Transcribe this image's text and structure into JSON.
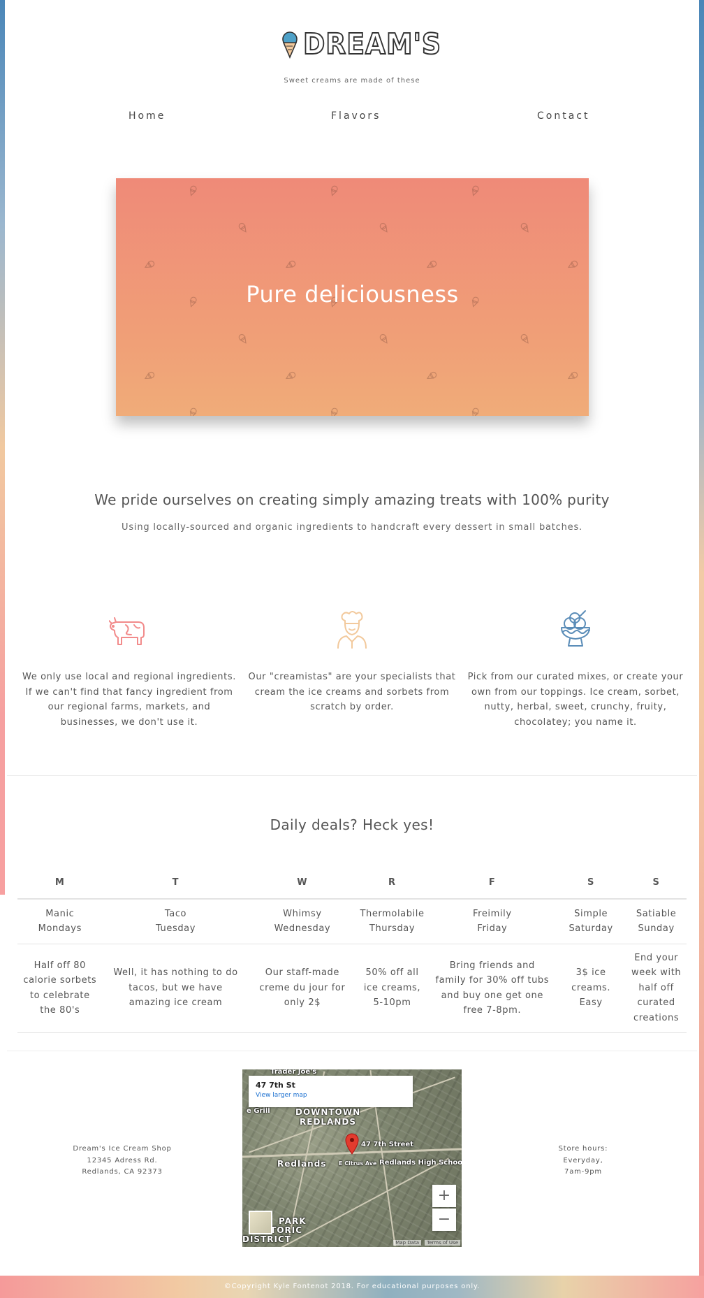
{
  "brand": {
    "logo_text": "DREAM'S",
    "tagline": "Sweet creams are made of these"
  },
  "nav": {
    "items": [
      {
        "label": "Home"
      },
      {
        "label": "Flavors"
      },
      {
        "label": "Contact"
      }
    ]
  },
  "hero": {
    "title": "Pure deliciousness"
  },
  "pride": {
    "heading": "We pride ourselves on creating simply amazing treats with 100% purity",
    "subheading": "Using locally-sourced and organic ingredients to handcraft every dessert in small batches."
  },
  "features": [
    {
      "icon": "cow-icon",
      "text": "We only use local and regional ingredients. If we can't find that fancy ingredient from our regional farms, markets, and businesses, we don't use it."
    },
    {
      "icon": "chef-icon",
      "text": "Our \"creamistas\" are your specialists that cream the ice creams and sorbets from scratch by order."
    },
    {
      "icon": "sundae-icon",
      "text": "Pick from our curated mixes, or create your own from our toppings. Ice cream, sorbet, nutty, herbal, sweet, crunchy, fruity, chocolatey; you name it."
    }
  ],
  "deals": {
    "title": "Daily deals? Heck yes!",
    "days": [
      "M",
      "T",
      "W",
      "R",
      "F",
      "S",
      "S"
    ],
    "names": [
      [
        "Manic",
        "Mondays"
      ],
      [
        "Taco",
        "Tuesday"
      ],
      [
        "Whimsy",
        "Wednesday"
      ],
      [
        "Thermolabile",
        "Thursday"
      ],
      [
        "Freimily",
        "Friday"
      ],
      [
        "Simple",
        "Saturday"
      ],
      [
        "Satiable",
        "Sunday"
      ]
    ],
    "descriptions": [
      "Half off 80 calorie sorbets to celebrate the 80's",
      "Well, it has nothing to do tacos, but we have amazing ice cream",
      "Our staff-made creme du jour for only 2$",
      "50% off all ice creams, 5-10pm",
      "Bring friends and family for 30% off tubs and buy one get one free 7-8pm.",
      "3$ ice creams. Easy",
      "End your week with half off curated creations"
    ]
  },
  "contact": {
    "address_lines": [
      "Dream's Ice Cream Shop",
      "12345 Adress Rd.",
      "Redlands, CA 92373"
    ],
    "hours_lines": [
      "Store hours:",
      "Everyday,",
      "7am-9pm"
    ]
  },
  "map": {
    "address": "47 7th St",
    "link": "View larger map",
    "labels": {
      "downtown": "DOWNTOWN",
      "redlands_upper": "REDLANDS",
      "street": "47 7th Street",
      "citrus": "E Citrus Ave",
      "highschool": "Redlands High School",
      "redlands": "Redlands",
      "park": "PARK",
      "historic": "HISTORIC",
      "district": "DISTRICT",
      "trader": "Trader Joe's",
      "grill": "e Grill"
    },
    "zoom_in": "+",
    "zoom_out": "−",
    "footer_data": "Map Data",
    "footer_terms": "Terms of Use"
  },
  "footer": {
    "copyright": "©Copyright Kyle Fontenot 2018. For educational purposes only."
  },
  "colors": {
    "hero_top": "#ef8a78",
    "hero_bottom": "#f0ac79",
    "cow": "#f28b8b",
    "chef": "#f2c99c",
    "sundae": "#5b8db8"
  }
}
